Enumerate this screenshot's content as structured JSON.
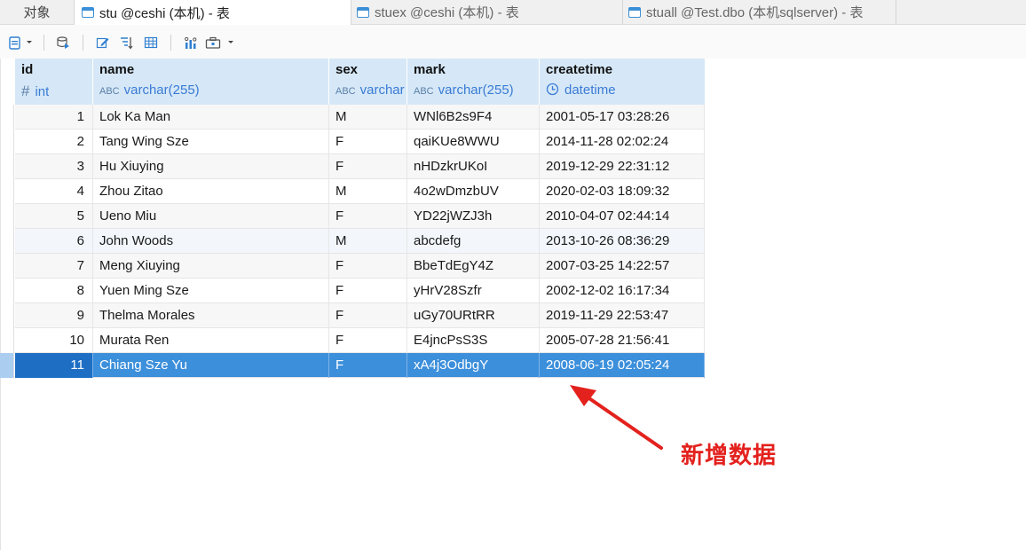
{
  "tabs": {
    "objects": "对象",
    "active": "stu @ceshi (本机) - 表",
    "tab2": "stuex @ceshi (本机) - 表",
    "tab3": "stuall @Test.dbo (本机sqlserver) - 表"
  },
  "columns": [
    {
      "name": "id",
      "type": "int",
      "type_icon": "#"
    },
    {
      "name": "name",
      "type": "varchar(255)",
      "type_icon": "ABC"
    },
    {
      "name": "sex",
      "type": "varchar",
      "type_icon": "ABC"
    },
    {
      "name": "mark",
      "type": "varchar(255)",
      "type_icon": "ABC"
    },
    {
      "name": "createtime",
      "type": "datetime",
      "type_icon": "clock"
    }
  ],
  "rows": [
    {
      "id": "1",
      "name": "Lok Ka Man",
      "sex": "M",
      "mark": "WNl6B2s9F4",
      "createtime": "2001-05-17 03:28:26"
    },
    {
      "id": "2",
      "name": "Tang Wing Sze",
      "sex": "F",
      "mark": "qaiKUe8WWU",
      "createtime": "2014-11-28 02:02:24"
    },
    {
      "id": "3",
      "name": "Hu Xiuying",
      "sex": "F",
      "mark": "nHDzkrUKoI",
      "createtime": "2019-12-29 22:31:12"
    },
    {
      "id": "4",
      "name": "Zhou Zitao",
      "sex": "M",
      "mark": "4o2wDmzbUV",
      "createtime": "2020-02-03 18:09:32"
    },
    {
      "id": "5",
      "name": "Ueno Miu",
      "sex": "F",
      "mark": "YD22jWZJ3h",
      "createtime": "2010-04-07 02:44:14"
    },
    {
      "id": "6",
      "name": "John Woods",
      "sex": "M",
      "mark": "abcdefg",
      "createtime": "2013-10-26 08:36:29"
    },
    {
      "id": "7",
      "name": "Meng Xiuying",
      "sex": "F",
      "mark": "BbeTdEgY4Z",
      "createtime": "2007-03-25 14:22:57"
    },
    {
      "id": "8",
      "name": "Yuen Ming Sze",
      "sex": "F",
      "mark": "yHrV28Szfr",
      "createtime": "2002-12-02 16:17:34"
    },
    {
      "id": "9",
      "name": "Thelma Morales",
      "sex": "F",
      "mark": "uGy70URtRR",
      "createtime": "2019-11-29 22:53:47"
    },
    {
      "id": "10",
      "name": "Murata Ren",
      "sex": "F",
      "mark": "E4jncPsS3S",
      "createtime": "2005-07-28 21:56:41"
    },
    {
      "id": "11",
      "name": "Chiang Sze Yu",
      "sex": "F",
      "mark": "xA4j3OdbgY",
      "createtime": "2008-06-19 02:05:24"
    }
  ],
  "selected_row_index": 10,
  "annotation": {
    "text": "新增数据",
    "color": "#e3211d"
  },
  "colors": {
    "header_bg": "#d6e8f7",
    "selection": "#3c8fdb",
    "type_text": "#3a7bd5"
  }
}
